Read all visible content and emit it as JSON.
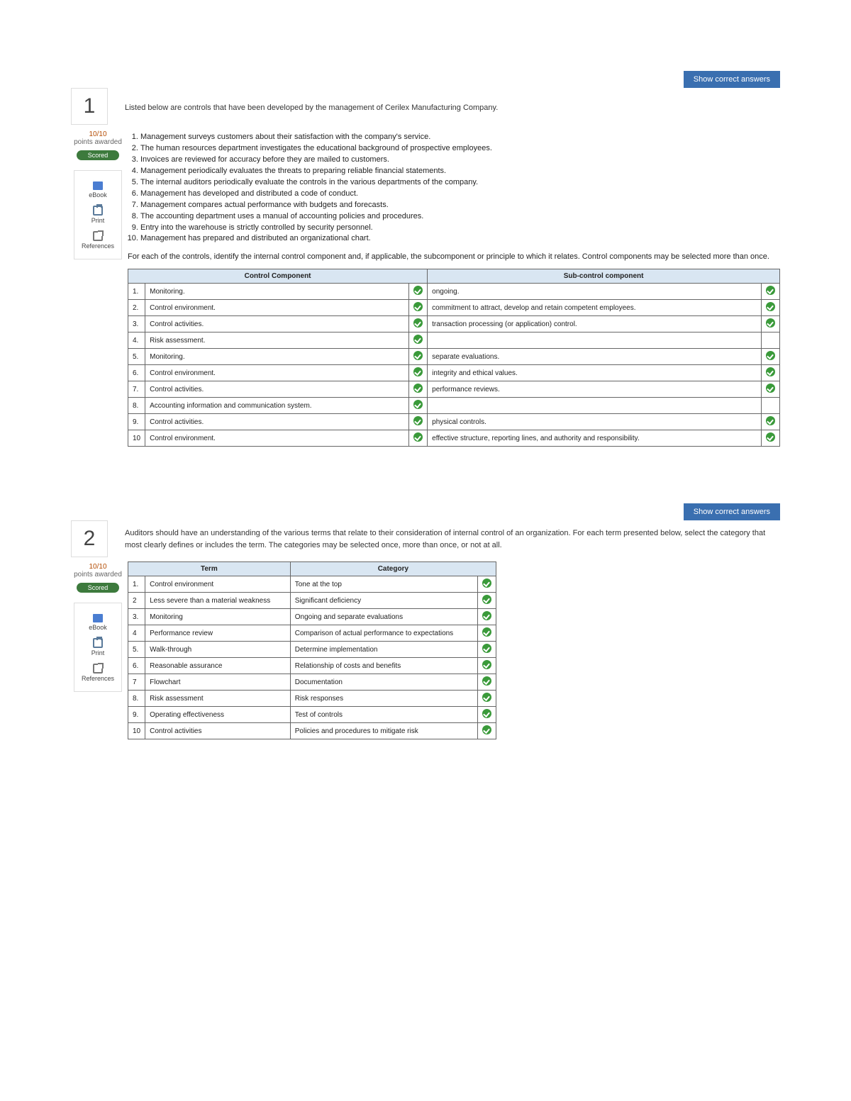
{
  "buttons": {
    "show_answers": "Show correct answers"
  },
  "sidebar": {
    "points_value": "10/10",
    "points_label": "points awarded",
    "scored_label": "Scored",
    "tools": {
      "ebook": "eBook",
      "print": "Print",
      "references": "References"
    }
  },
  "q1": {
    "number": "1",
    "intro": "Listed below are controls that have been developed by the management of Cerilex Manufacturing Company.",
    "controls": [
      "Management surveys customers about their satisfaction with the company's service.",
      "The human resources department investigates the educational background of prospective employees.",
      "Invoices are reviewed for accuracy before they are mailed to customers.",
      "Management periodically evaluates the threats to preparing reliable financial statements.",
      "The internal auditors periodically evaluate the controls in the various departments of the company.",
      "Management has developed and distributed a code of conduct.",
      "Management compares actual performance with budgets and forecasts.",
      "The accounting department uses a manual of accounting policies and procedures.",
      "Entry into the warehouse is strictly controlled by security personnel.",
      "Management has prepared and distributed an organizational chart."
    ],
    "instruction": "For each of the controls, identify the internal control component and, if applicable, the subcomponent or principle to which it relates. Control components may be selected more than once.",
    "table": {
      "headers": [
        "Control Component",
        "Sub-control component"
      ],
      "rows": [
        {
          "n": "1.",
          "c1": "Monitoring.",
          "m1": true,
          "c2": "ongoing.",
          "m2": true
        },
        {
          "n": "2.",
          "c1": "Control environment.",
          "m1": true,
          "c2": "commitment to attract, develop and retain competent employees.",
          "m2": true
        },
        {
          "n": "3.",
          "c1": "Control activities.",
          "m1": true,
          "c2": "transaction processing (or application) control.",
          "m2": true
        },
        {
          "n": "4.",
          "c1": "Risk assessment.",
          "m1": true,
          "c2": "",
          "m2": false
        },
        {
          "n": "5.",
          "c1": "Monitoring.",
          "m1": true,
          "c2": "separate evaluations.",
          "m2": true
        },
        {
          "n": "6.",
          "c1": "Control environment.",
          "m1": true,
          "c2": "integrity and ethical values.",
          "m2": true
        },
        {
          "n": "7.",
          "c1": "Control activities.",
          "m1": true,
          "c2": "performance reviews.",
          "m2": true
        },
        {
          "n": "8.",
          "c1": "Accounting information and communication system.",
          "m1": true,
          "c2": "",
          "m2": false
        },
        {
          "n": "9.",
          "c1": "Control activities.",
          "m1": true,
          "c2": "physical controls.",
          "m2": true
        },
        {
          "n": "10",
          "c1": "Control environment.",
          "m1": true,
          "c2": "effective structure, reporting lines, and authority and responsibility.",
          "m2": true
        }
      ]
    }
  },
  "q2": {
    "number": "2",
    "intro": "Auditors should have an understanding of the various terms that relate to their consideration of internal control of an organization. For each term presented below, select the category that most clearly defines or includes the term. The categories may be selected once, more than once, or not at all.",
    "table": {
      "headers": [
        "Term",
        "Category"
      ],
      "rows": [
        {
          "n": "1.",
          "c1": "Control environment",
          "c2": "Tone at the top",
          "m": true
        },
        {
          "n": "2",
          "c1": "Less severe than a material weakness",
          "c2": "Significant deficiency",
          "m": true
        },
        {
          "n": "3.",
          "c1": "Monitoring",
          "c2": "Ongoing and separate evaluations",
          "m": true
        },
        {
          "n": "4",
          "c1": "Performance review",
          "c2": "Comparison of actual performance to expectations",
          "m": true
        },
        {
          "n": "5.",
          "c1": "Walk-through",
          "c2": "Determine implementation",
          "m": true
        },
        {
          "n": "6.",
          "c1": "Reasonable assurance",
          "c2": "Relationship of costs and benefits",
          "m": true
        },
        {
          "n": "7",
          "c1": "Flowchart",
          "c2": "Documentation",
          "m": true
        },
        {
          "n": "8.",
          "c1": "Risk assessment",
          "c2": "Risk responses",
          "m": true
        },
        {
          "n": "9.",
          "c1": "Operating effectiveness",
          "c2": "Test of controls",
          "m": true
        },
        {
          "n": "10",
          "c1": "Control activities",
          "c2": "Policies and procedures to mitigate risk",
          "m": true
        }
      ]
    }
  }
}
